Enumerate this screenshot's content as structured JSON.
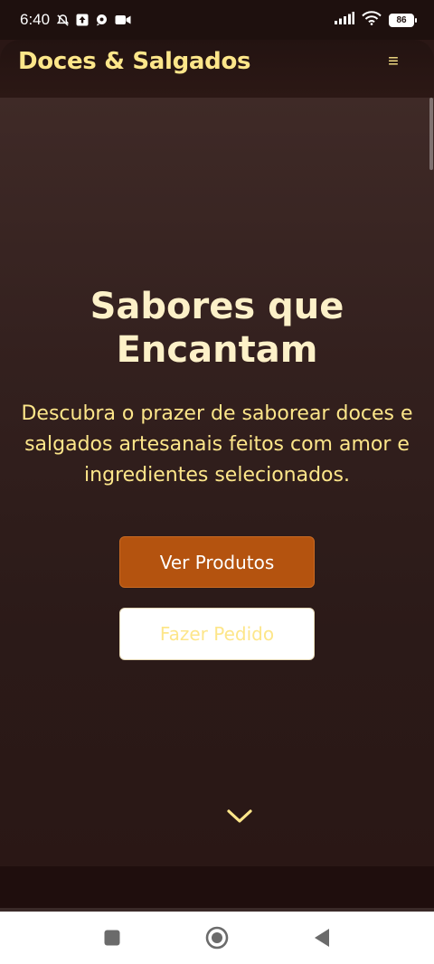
{
  "status_bar": {
    "time": "6:40",
    "battery": "86",
    "icons": [
      "mute-alarm-icon",
      "upload-icon",
      "chat-icon",
      "video-icon",
      "signal-icon",
      "wifi-icon",
      "battery-icon"
    ]
  },
  "header": {
    "brand": "Doces & Salgados",
    "menu_icon": "hamburger-menu-icon",
    "menu_glyph": "≡"
  },
  "hero": {
    "title": "Sabores que Encantam",
    "subtitle": "Descubra o prazer de saborear doces e salgados artesanais feitos com amor e ingredientes selecionados.",
    "primary_button": "Ver Produtos",
    "secondary_button": "Fazer Pedido",
    "scroll_icon": "chevron-down-icon"
  },
  "colors": {
    "accent": "#fde68a",
    "primary_button": "#b4530f",
    "background": "#2a1715"
  },
  "nav_bar": {
    "icons": [
      "recent-apps-icon",
      "home-icon",
      "back-icon"
    ]
  }
}
